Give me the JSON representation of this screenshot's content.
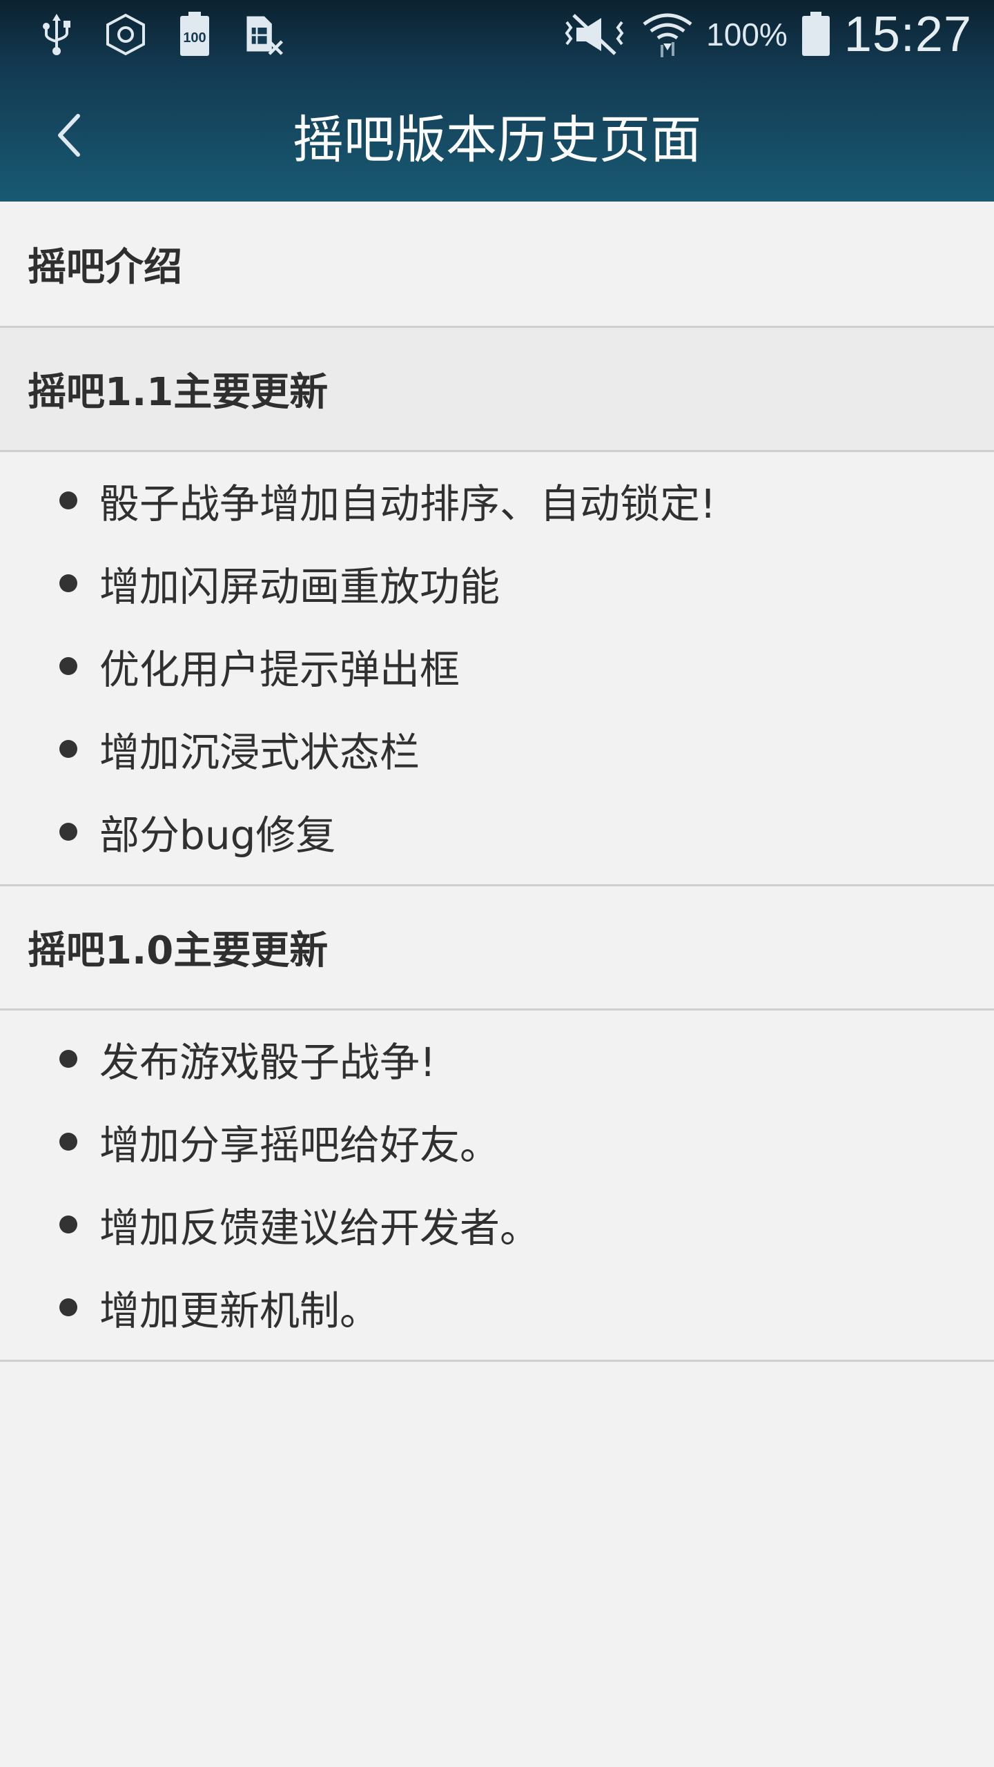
{
  "status_bar": {
    "icons_left": [
      "usb-icon",
      "hexagon-icon",
      "battery-100-icon",
      "sim-x-icon"
    ],
    "icons_right": [
      "vibrate-icon",
      "wifi-icon"
    ],
    "battery_percent": "100%",
    "time": "15:27"
  },
  "app_bar": {
    "back_icon": "chevron-left-icon",
    "title": "摇吧版本历史页面"
  },
  "sections": [
    {
      "title": "摇吧介绍",
      "items": []
    },
    {
      "title": "摇吧1.1主要更新",
      "items": [
        "骰子战争增加自动排序、自动锁定!",
        "增加闪屏动画重放功能",
        "优化用户提示弹出框",
        "增加沉浸式状态栏",
        "部分bug修复"
      ]
    },
    {
      "title": "摇吧1.0主要更新",
      "items": [
        "发布游戏骰子战争!",
        "增加分享摇吧给好友。",
        "增加反馈建议给开发者。",
        "增加更新机制。"
      ]
    }
  ],
  "colors": {
    "app_bar": "#185a73",
    "status_bar": "#0b2230",
    "background": "#f2f2f2",
    "divider": "#cfcfcf"
  }
}
